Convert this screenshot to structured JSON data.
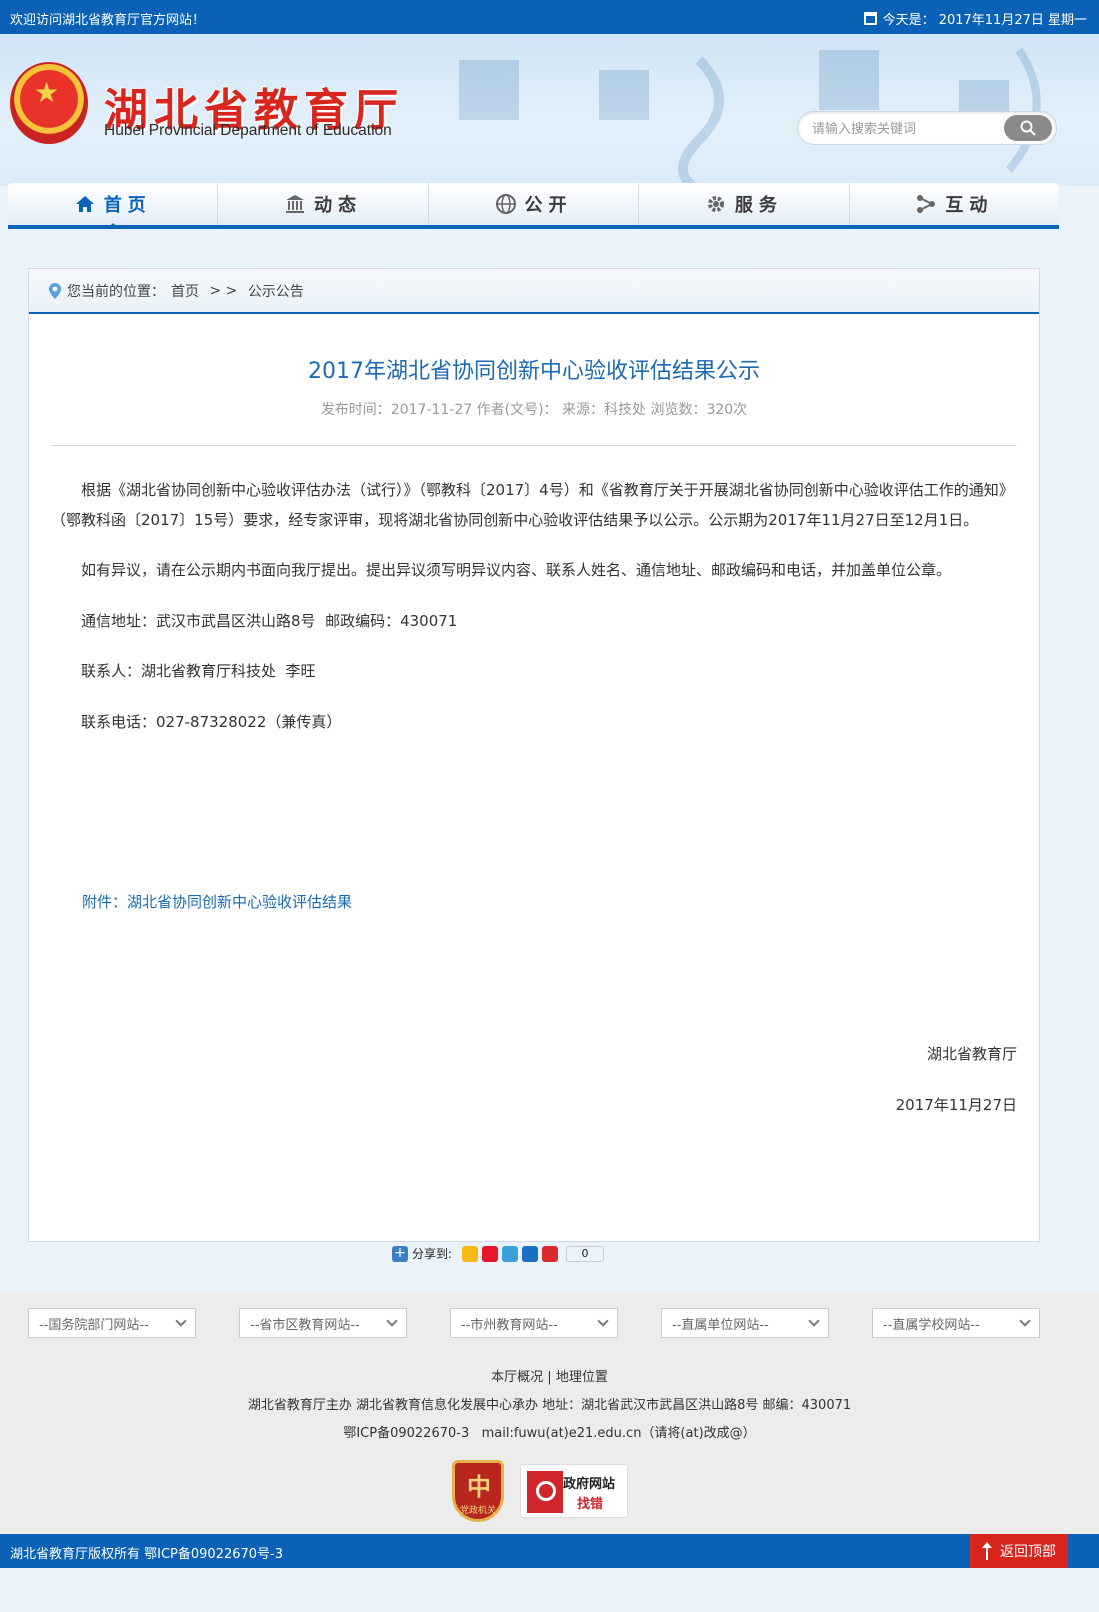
{
  "topbar": {
    "welcome": "欢迎访问湖北省教育厅官方网站！",
    "date": "今天是： 2017年11月27日 星期一"
  },
  "header": {
    "title": "湖北省教育厅",
    "subtitle": "Hubei Provincial Department of Education",
    "search_placeholder": "请输入搜索关键词"
  },
  "nav": [
    {
      "label": "首页",
      "icon": "home-icon"
    },
    {
      "label": "动态",
      "icon": "building-icon"
    },
    {
      "label": "公开",
      "icon": "globe-icon"
    },
    {
      "label": "服务",
      "icon": "gear-icon"
    },
    {
      "label": "互动",
      "icon": "share-nodes-icon"
    }
  ],
  "breadcrumb": {
    "prefix": "您当前的位置：",
    "home": "首页",
    "sep": " > > ",
    "current": "公示公告"
  },
  "article": {
    "title": "2017年湖北省协同创新中心验收评估结果公示",
    "meta": "发布时间：2017-11-27 作者(文号)： 来源：科技处 浏览数：320次",
    "p1": "根据《湖北省协同创新中心验收评估办法（试行）》（鄂教科〔2017〕4号）和《省教育厅关于开展湖北省协同创新中心验收评估工作的通知》（鄂教科函〔2017〕15号）要求，经专家评审，现将湖北省协同创新中心验收评估结果予以公示。公示期为2017年11月27日至12月1日。",
    "p2": "如有异议，请在公示期内书面向我厅提出。提出异议须写明异议内容、联系人姓名、通信地址、邮政编码和电话，并加盖单位公章。",
    "p3": "通信地址：武汉市武昌区洪山路8号  邮政编码：430071",
    "p4": "联系人：湖北省教育厅科技处  李旺",
    "p5": "联系电话：027-87328022（兼传真）",
    "attachment": "附件：湖北省协同创新中心验收评估结果",
    "signature": "湖北省教育厅",
    "sign_date": "2017年11月27日"
  },
  "share": {
    "label": "分享到:",
    "count": "0"
  },
  "footer": {
    "selects": [
      "--国务院部门网站--",
      "--省市区教育网站--",
      "--市州教育网站--",
      "--直属单位网站--",
      "--直属学校网站--"
    ],
    "link1": "本厅概况",
    "link_sep": "|",
    "link2": "地理位置",
    "info": "湖北省教育厅主办 湖北省教育信息化发展中心承办 地址：湖北省武汉市武昌区洪山路8号 邮编：430071",
    "icp": "鄂ICP备09022670-3   mail:fuwu(at)e21.edu.cn（请将(at)改成@）",
    "badge1_text": "党政机关",
    "badge2_line1": "政府网站",
    "badge2_line2": "找错",
    "copyright": "湖北省教育厅版权所有 鄂ICP备09022670号-3",
    "backtop": "返回顶部"
  },
  "colors": {
    "primary": "#0a61b5",
    "accent_red": "#d8261f",
    "link": "#1c6ab3"
  }
}
